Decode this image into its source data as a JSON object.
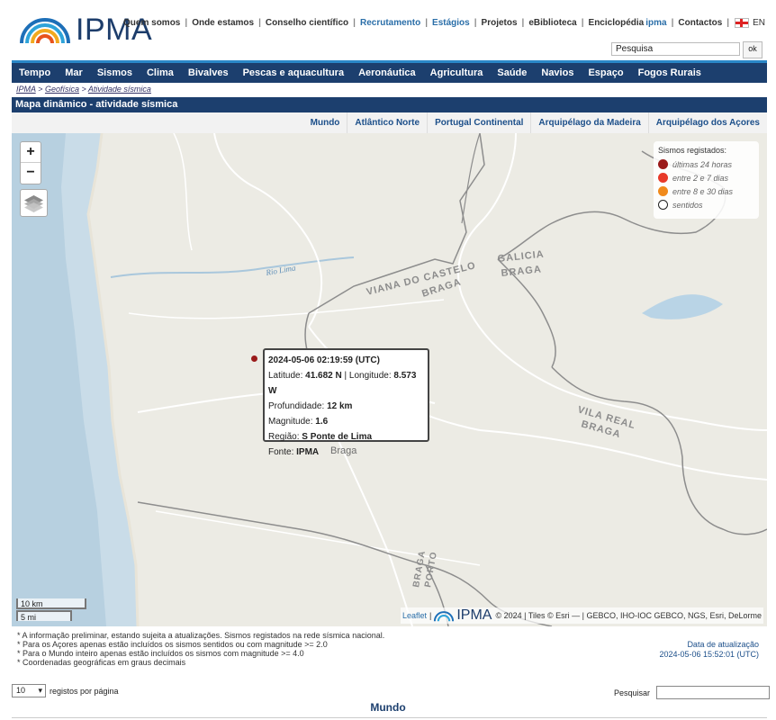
{
  "brand": {
    "name": "IPMA"
  },
  "top_links": [
    {
      "label": "Quem somos",
      "blue": false
    },
    {
      "label": "Onde estamos",
      "blue": false
    },
    {
      "label": "Conselho científico",
      "blue": false
    },
    {
      "label": "Recrutamento",
      "blue": true
    },
    {
      "label": "Estágios",
      "blue": true
    },
    {
      "label": "Projetos",
      "blue": false
    },
    {
      "label": "eBiblioteca",
      "blue": false
    },
    {
      "label": "Enciclopédia",
      "extra": "ipma",
      "blue": false
    },
    {
      "label": "Contactos",
      "blue": false
    }
  ],
  "language": "EN",
  "search": {
    "placeholder": "Pesquisa",
    "button": "ok"
  },
  "nav": [
    "Tempo",
    "Mar",
    "Sismos",
    "Clima",
    "Bivalves",
    "Pescas e aquacultura",
    "Aeronáutica",
    "Agricultura",
    "Saúde",
    "Navios",
    "Espaço",
    "Fogos Rurais"
  ],
  "breadcrumb": [
    "IPMA",
    "Geofísica",
    "Atividade sísmica"
  ],
  "page_title": "Mapa dinâmico - atividade sísmica",
  "region_tabs": [
    "Mundo",
    "Atlântico Norte",
    "Portugal Continental",
    "Arquipélago da Madeira",
    "Arquipélago dos Açores"
  ],
  "map": {
    "zoom_in": "+",
    "zoom_out": "−",
    "labels": {
      "rio_lima": "Rio Lima",
      "viana": "VIANA DO CASTELO",
      "braga1": "BRAGA",
      "galicia": "GALICIA",
      "braga2": "BRAGA",
      "vila_real": "VILA REAL",
      "braga3": "BRAGA",
      "braga_city": "Braga",
      "braga4": "BRAGA",
      "porto": "PORTO"
    },
    "legend": {
      "title": "Sismos registados:",
      "items": [
        {
          "label": "últimas 24 horas",
          "color": "#9a1a1a"
        },
        {
          "label": "entre 2 e 7 dias",
          "color": "#e83a2a"
        },
        {
          "label": "entre 8 e 30 dias",
          "color": "#f08a1c"
        },
        {
          "label": "sentidos",
          "color": "#ffffff"
        }
      ]
    },
    "popup": {
      "time": "2024-05-06 02:19:59 (UTC)",
      "latitude_label": "Latitude:",
      "latitude": "41.682 N",
      "longitude_label": "Longitude:",
      "longitude": "8.573 W",
      "depth_label": "Profundidade:",
      "depth": "12 km",
      "magnitude_label": "Magnitude:",
      "magnitude": "1.6",
      "region_label": "Região:",
      "region": "S Ponte de Lima",
      "source_label": "Fonte:",
      "source": "IPMA"
    },
    "scale": {
      "km": "10 km",
      "mi": "5 mi"
    },
    "attribution": {
      "leaflet": "Leaflet",
      "logo": "IPMA",
      "text": "© 2024 | Tiles © Esri — | GEBCO, IHO-IOC GEBCO, NGS, Esri, DeLorme"
    }
  },
  "notes": [
    "* A informação preliminar, estando sujeita a atualizações. Sismos registados na rede sísmica nacional.",
    "* Para os Açores apenas estão incluídos os sismos sentidos ou com magnitude >= 2.0",
    "* Para o Mundo inteiro apenas estão incluídos os sismos com magnitude >= 4.0",
    "* Coordenadas geográficas em graus decimais"
  ],
  "update": {
    "label": "Data de atualização",
    "value": "2024-05-06 15:52:01 (UTC)"
  },
  "table": {
    "per_page_value": "10",
    "per_page_label": "registos por página",
    "search_label": "Pesquisar"
  },
  "section_title": "Mundo"
}
